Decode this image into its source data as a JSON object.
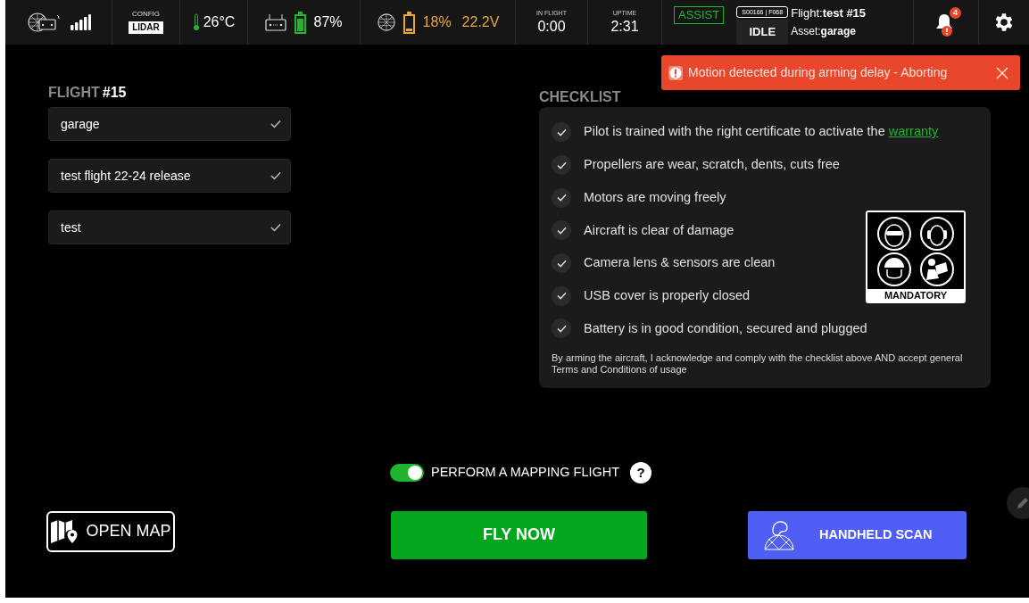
{
  "status_bar": {
    "config": {
      "label": "CONFIG",
      "value": "LIDAR"
    },
    "temperature": "26°C",
    "controller_battery": {
      "percent": "87%",
      "level": 0.85
    },
    "drone_battery": {
      "percent": "18%",
      "voltage": "22.2V",
      "level": 0.18
    },
    "in_flight": {
      "label": "IN FLIGHT",
      "value": "0:00"
    },
    "uptime": {
      "label": "UPTIME",
      "value": "2:31"
    },
    "mode": "ASSIST",
    "serial": "S00166 | F068",
    "state": "IDLE",
    "flight": {
      "label": "Flight:",
      "value": "test #15"
    },
    "asset": {
      "label": "Asset:",
      "value": "garage"
    },
    "notifications": "4"
  },
  "toast": {
    "message": "Motion detected during arming delay - Aborting"
  },
  "flight_panel": {
    "title_label": "FLIGHT",
    "title_number": "#15",
    "fields": [
      {
        "value": "garage"
      },
      {
        "value": "test flight 22-24 release"
      },
      {
        "value": "test"
      }
    ]
  },
  "checklist": {
    "title": "CHECKLIST",
    "items": [
      {
        "text": "Pilot is trained with the right certificate to activate the",
        "link": "warranty",
        "checked": true
      },
      {
        "text": "Propellers are wear, scratch, dents, cuts free",
        "checked": true
      },
      {
        "text": "Motors are moving freely",
        "checked": true
      },
      {
        "text": "Aircraft is clear of damage",
        "checked": true
      },
      {
        "text": "Camera lens & sensors are clean",
        "checked": true
      },
      {
        "text": "USB cover is properly closed",
        "checked": true
      },
      {
        "text": "Battery is in good condition, secured and plugged",
        "checked": true
      }
    ],
    "sign_label": "MANDATORY",
    "disclaimer": "By arming the aircraft, I acknowledge and comply with the checklist above AND accept general Terms and Conditions of usage"
  },
  "mapping_toggle": {
    "label": "PERFORM A MAPPING FLIGHT",
    "on": true,
    "help": "?"
  },
  "buttons": {
    "open_map": "OPEN MAP",
    "fly_now": "FLY NOW",
    "handheld_scan": "HANDHELD SCAN"
  }
}
